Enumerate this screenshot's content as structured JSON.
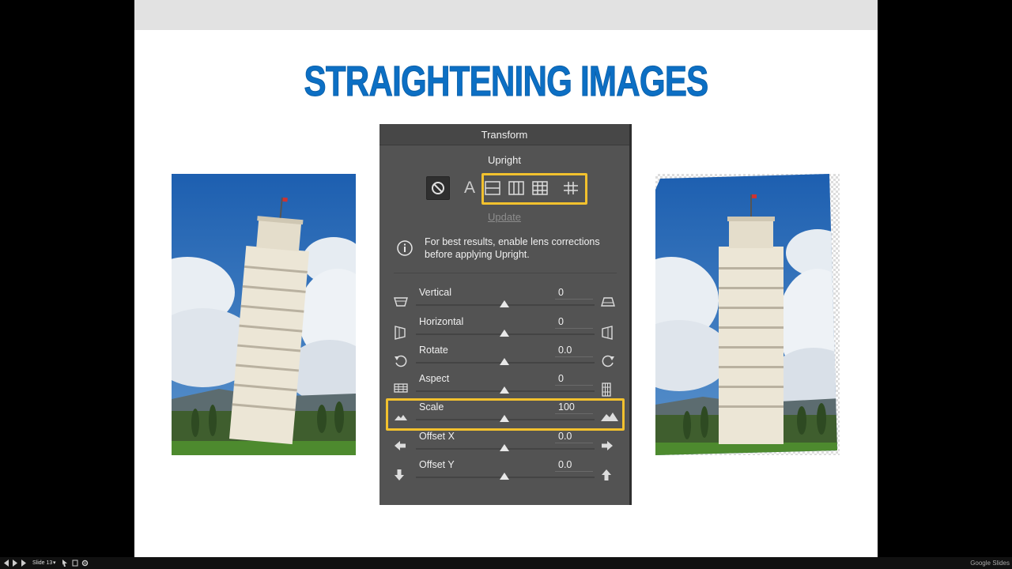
{
  "slide": {
    "title": "STRAIGHTENING IMAGES"
  },
  "panel": {
    "header": "Transform",
    "upright_label": "Upright",
    "auto_label": "A",
    "update_label": "Update",
    "info_text": "For best results, enable lens corrections before applying Upright.",
    "sliders": [
      {
        "label": "Vertical",
        "value": "0"
      },
      {
        "label": "Horizontal",
        "value": "0"
      },
      {
        "label": "Rotate",
        "value": "0.0"
      },
      {
        "label": "Aspect",
        "value": "0"
      },
      {
        "label": "Scale",
        "value": "100"
      },
      {
        "label": "Offset X",
        "value": "0.0"
      },
      {
        "label": "Offset Y",
        "value": "0.0"
      }
    ]
  },
  "bottom_bar": {
    "slide_label": "Slide 13",
    "brand": "Google Slides"
  },
  "colors": {
    "title": "#0c6fc4",
    "highlight": "#f2c12e",
    "panel_bg": "#535353"
  }
}
